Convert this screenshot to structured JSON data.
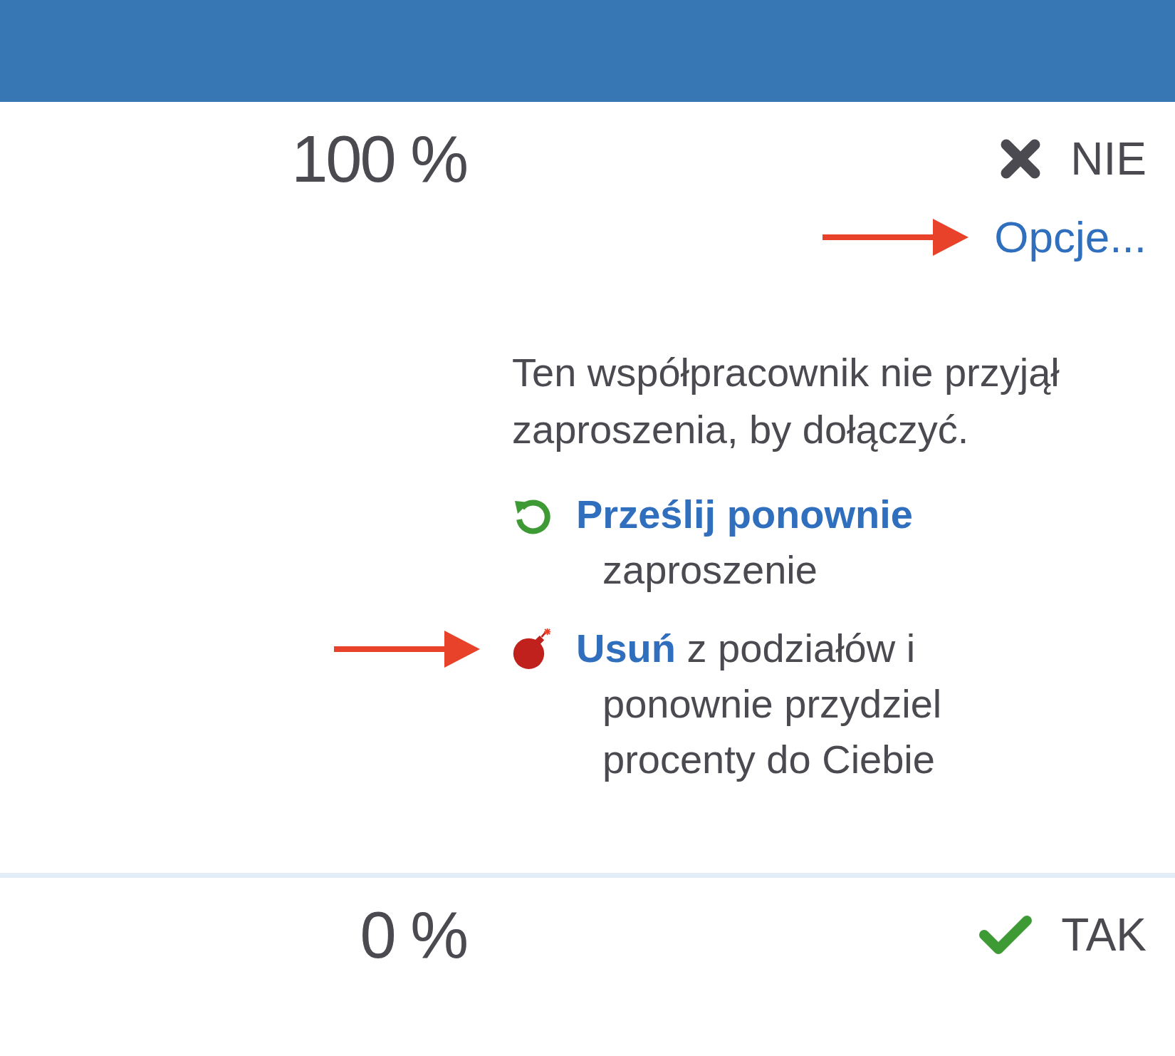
{
  "rows": [
    {
      "percent": "100 %",
      "status": {
        "kind": "no",
        "label": "NIE"
      },
      "options": {
        "label": "Opcje...",
        "annotated": true
      },
      "note": "Ten współpracownik nie przyjął zaproszenia, by dołączyć.",
      "actions": [
        {
          "kind": "resend",
          "link": "Prześlij ponownie",
          "text": "zaproszenie",
          "annotated": false
        },
        {
          "kind": "remove",
          "link": "Usuń",
          "text": "z podziałów i ponownie przydziel procenty do Ciebie",
          "annotated": true
        }
      ]
    },
    {
      "percent": "0 %",
      "status": {
        "kind": "yes",
        "label": "TAK"
      }
    }
  ]
}
